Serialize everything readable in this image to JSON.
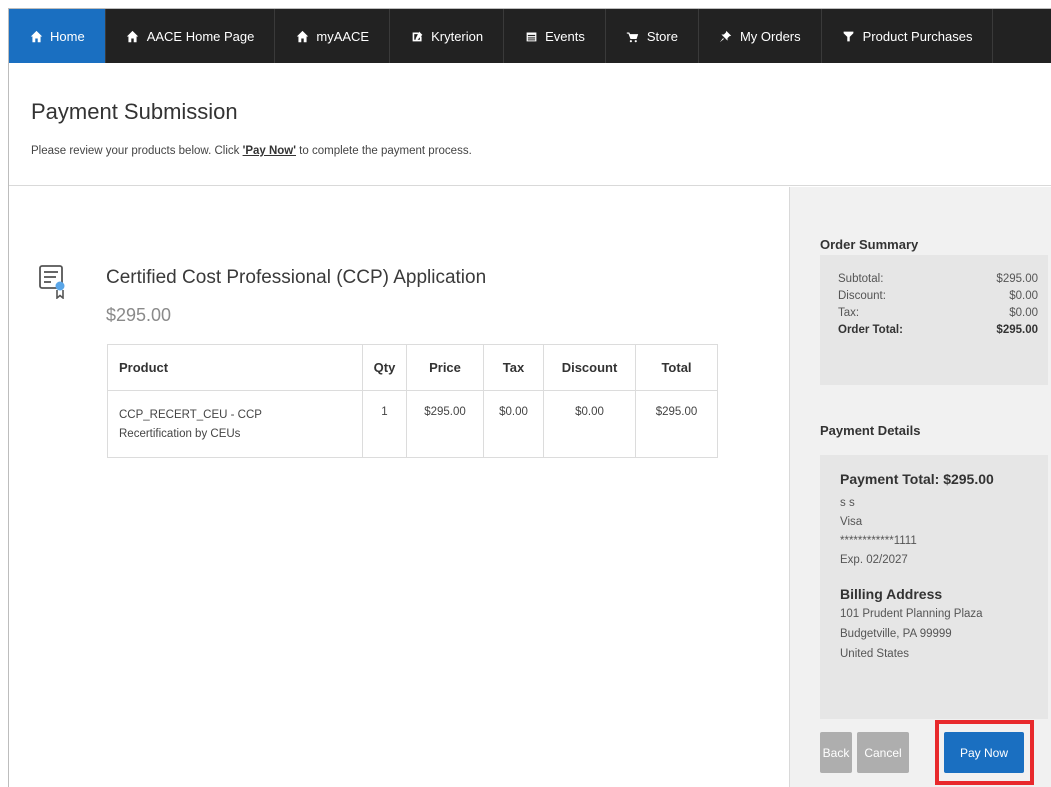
{
  "nav": {
    "items": [
      {
        "label": "Home",
        "icon": "home-icon",
        "active": true
      },
      {
        "label": "AACE Home Page",
        "icon": "home-icon"
      },
      {
        "label": "myAACE",
        "icon": "home-icon"
      },
      {
        "label": "Kryterion",
        "icon": "edit-icon"
      },
      {
        "label": "Events",
        "icon": "calendar-icon"
      },
      {
        "label": "Store",
        "icon": "cart-icon"
      },
      {
        "label": "My Orders",
        "icon": "pin-icon"
      },
      {
        "label": "Product Purchases",
        "icon": "filter-icon"
      }
    ]
  },
  "header": {
    "title": "Payment Submission",
    "sub_before": "Please review your products below. Click ",
    "sub_link": "'Pay Now'",
    "sub_after": " to complete the payment process."
  },
  "product": {
    "icon": "certificate-icon",
    "title": "Certified Cost Professional (CCP) Application",
    "price": "$295.00"
  },
  "table": {
    "headers": {
      "product": "Product",
      "qty": "Qty",
      "price": "Price",
      "tax": "Tax",
      "discount": "Discount",
      "total": "Total"
    },
    "rows": [
      {
        "product_line1": "CCP_RECERT_CEU - CCP",
        "product_line2": "Recertification by CEUs",
        "qty": "1",
        "price": "$295.00",
        "tax": "$0.00",
        "discount": "$0.00",
        "total": "$295.00"
      }
    ]
  },
  "order_summary": {
    "title": "Order Summary",
    "subtotal_label": "Subtotal:",
    "subtotal": "$295.00",
    "discount_label": "Discount:",
    "discount": "$0.00",
    "tax_label": "Tax:",
    "tax": "$0.00",
    "total_label": "Order Total:",
    "total": "$295.00"
  },
  "payment": {
    "title": "Payment Details",
    "total_text": "Payment Total: $295.00",
    "name": "s s",
    "card_type": "Visa",
    "card_number": "************1111",
    "expiry": "Exp. 02/2027",
    "billing_title": "Billing Address",
    "address_line1": "101 Prudent Planning Plaza",
    "address_line2": "Budgetville, PA 99999",
    "address_country": "United States"
  },
  "buttons": {
    "back": "Back",
    "cancel": "Cancel",
    "pay_now": "Pay Now"
  },
  "colors": {
    "nav_bg": "#222222",
    "accent": "#1a6fc1",
    "highlight": "#e8292c"
  }
}
